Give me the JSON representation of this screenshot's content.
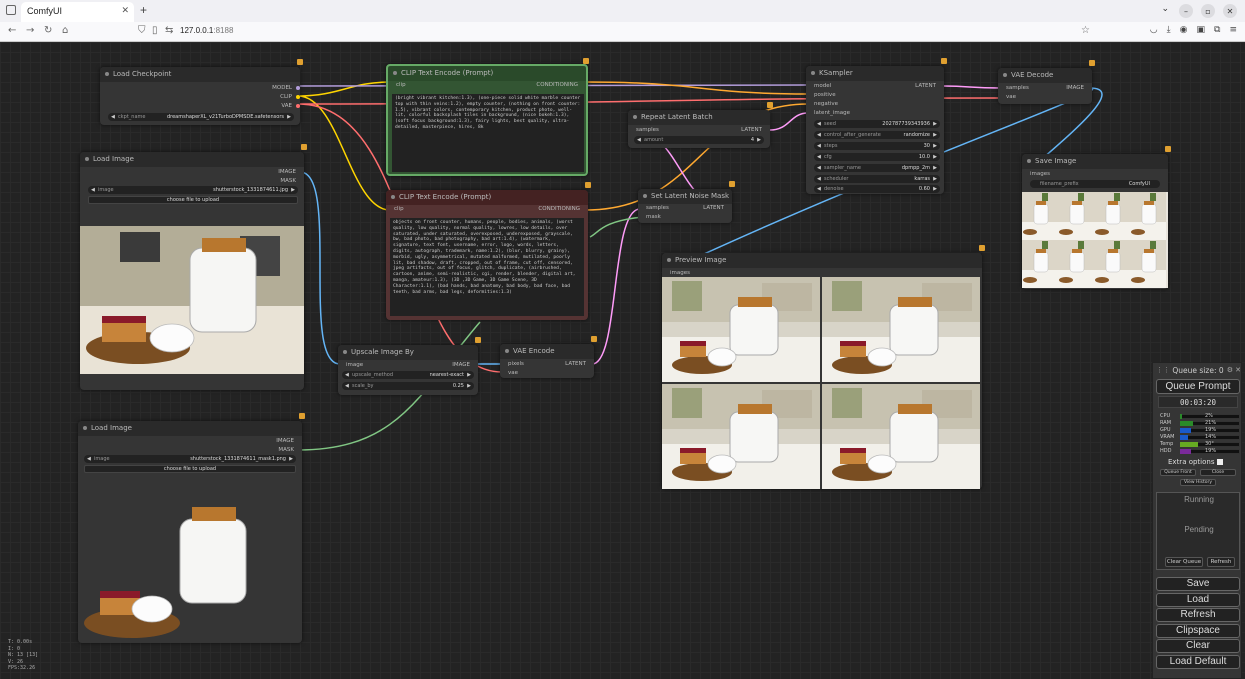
{
  "browser": {
    "tab_title": "ComfyUI",
    "url_host": "127.0.0.1",
    "url_port": ":8188"
  },
  "nodes": {
    "load_checkpoint": {
      "title": "Load Checkpoint",
      "outputs": [
        "MODEL",
        "CLIP",
        "VAE"
      ],
      "ckpt_label": "ckpt_name",
      "ckpt_value": "dreamshaperXL_v21TurboDPMSDE.safetensors"
    },
    "clip_pos": {
      "title": "CLIP Text Encode (Prompt)",
      "input": "clip",
      "output": "CONDITIONING",
      "text": "(bright vibrant kitchen:1.3), (one-piece solid white marble counter top with thin veins:1.2), empty counter, (nothing on front counter: 1.5), vibrant colors, contemporary kitchen, product photo, well-lit, colorful backsplash tiles in background, (nice bokeh:1.3), (soft focus background:1.3), fairy lights, best quality, ultra-detailed, masterpiece, hires, 8k"
    },
    "clip_neg": {
      "title": "CLIP Text Encode (Prompt)",
      "input": "clip",
      "output": "CONDITIONING",
      "text": "objects on front counter, humans, people, bodies, animals, (worst quality, low quality, normal quality, lowres, low details, over saturated, under saturated, overexposed, underexposed, grayscale, bw, bad photo, bad photography, bad art:1.4), (watermark, signature, text font, username, error, logo, words, letters, digits, autograph, trademark, name:1.2), (blur, blurry, grainy), morbid, ugly, asymmetrical, mutated malformed, mutilated, poorly lit, bad shadow, draft, cropped, out of frame, cut off, censored, jpeg artifacts, out of focus, glitch, duplicate, (airbrushed, cartoon, anime, semi-realistic, cgi, render, blender, digital art, manga, amateur:1.3), (3D ,3D Game, 3D Game Scene, 3D Character:1.1), (bad hands, bad anatomy, bad body, bad face, bad teeth, bad arms, bad legs, deformities:1.3)"
    },
    "ksampler": {
      "title": "KSampler",
      "inputs": [
        "model",
        "positive",
        "negative",
        "latent_image"
      ],
      "output": "LATENT",
      "widgets": [
        {
          "label": "seed",
          "value": "202787739343936"
        },
        {
          "label": "control_after_generate",
          "value": "randomize"
        },
        {
          "label": "steps",
          "value": "30"
        },
        {
          "label": "cfg",
          "value": "10.0"
        },
        {
          "label": "sampler_name",
          "value": "dpmpp_2m"
        },
        {
          "label": "scheduler",
          "value": "karras"
        },
        {
          "label": "denoise",
          "value": "0.60"
        }
      ]
    },
    "vae_decode": {
      "title": "VAE Decode",
      "inputs": [
        "samples",
        "vae"
      ],
      "output": "IMAGE"
    },
    "save_image": {
      "title": "Save Image",
      "input": "images",
      "prefix_label": "filename_prefix",
      "prefix_value": "ComfyUI"
    },
    "repeat_latent": {
      "title": "Repeat Latent Batch",
      "input": "samples",
      "output": "LATENT",
      "amount_label": "amount",
      "amount_value": "4"
    },
    "set_noise_mask": {
      "title": "Set Latent Noise Mask",
      "inputs": [
        "samples",
        "mask"
      ],
      "output": "LATENT"
    },
    "preview_image": {
      "title": "Preview Image",
      "input": "images"
    },
    "load_image_1": {
      "title": "Load Image",
      "outputs": [
        "IMAGE",
        "MASK"
      ],
      "image_label": "image",
      "image_value": "shutterstock_1331874611.jpg",
      "upload_label": "choose file to upload"
    },
    "load_image_2": {
      "title": "Load Image",
      "outputs": [
        "IMAGE",
        "MASK"
      ],
      "image_label": "image",
      "image_value": "shutterstock_1331874611_mask1.png",
      "upload_label": "choose file to upload"
    },
    "upscale": {
      "title": "Upscale Image By",
      "input": "image",
      "output": "IMAGE",
      "widgets": [
        {
          "label": "upscale_method",
          "value": "nearest-exact"
        },
        {
          "label": "scale_by",
          "value": "0.25"
        }
      ]
    },
    "vae_encode": {
      "title": "VAE Encode",
      "inputs": [
        "pixels",
        "vae"
      ],
      "output": "LATENT"
    }
  },
  "queue": {
    "title": "Queue size: 0",
    "queue_prompt": "Queue Prompt",
    "timer": "00:03:20",
    "monitors": [
      {
        "name": "CPU",
        "pct": "2%",
        "color": "#2a8a2a",
        "frac": 0.02
      },
      {
        "name": "RAM",
        "pct": "21%",
        "color": "#2a8a2a",
        "frac": 0.21
      },
      {
        "name": "GPU",
        "pct": "19%",
        "color": "#1a5acc",
        "frac": 0.19
      },
      {
        "name": "VRAM",
        "pct": "14%",
        "color": "#1a5acc",
        "frac": 0.14
      },
      {
        "name": "Temp",
        "pct": "30°",
        "color": "#66aa22",
        "frac": 0.3
      },
      {
        "name": "HDD",
        "pct": "19%",
        "color": "#7a2a9a",
        "frac": 0.19
      }
    ],
    "extra_options": "Extra options",
    "queue_front": "Queue Front",
    "close": "Close",
    "view_history": "View History",
    "running": "Running",
    "pending": "Pending",
    "clear_queue": "Clear Queue",
    "refresh_small": "Refresh",
    "buttons": [
      "Save",
      "Load",
      "Refresh",
      "Clipspace",
      "Clear",
      "Load Default"
    ]
  },
  "stats": [
    "T: 0.00s",
    "I: 0",
    "N: 13 [13]",
    "V: 26",
    "FPS:32.26"
  ],
  "colors": {
    "model_link": "#b39ddb",
    "clip_link": "#ffd500",
    "vae_link": "#ff6e6e",
    "conditioning_link": "#ffa931",
    "latent_link": "#ff9cf9",
    "image_link": "#64b5f6",
    "mask_link": "#81c784"
  }
}
